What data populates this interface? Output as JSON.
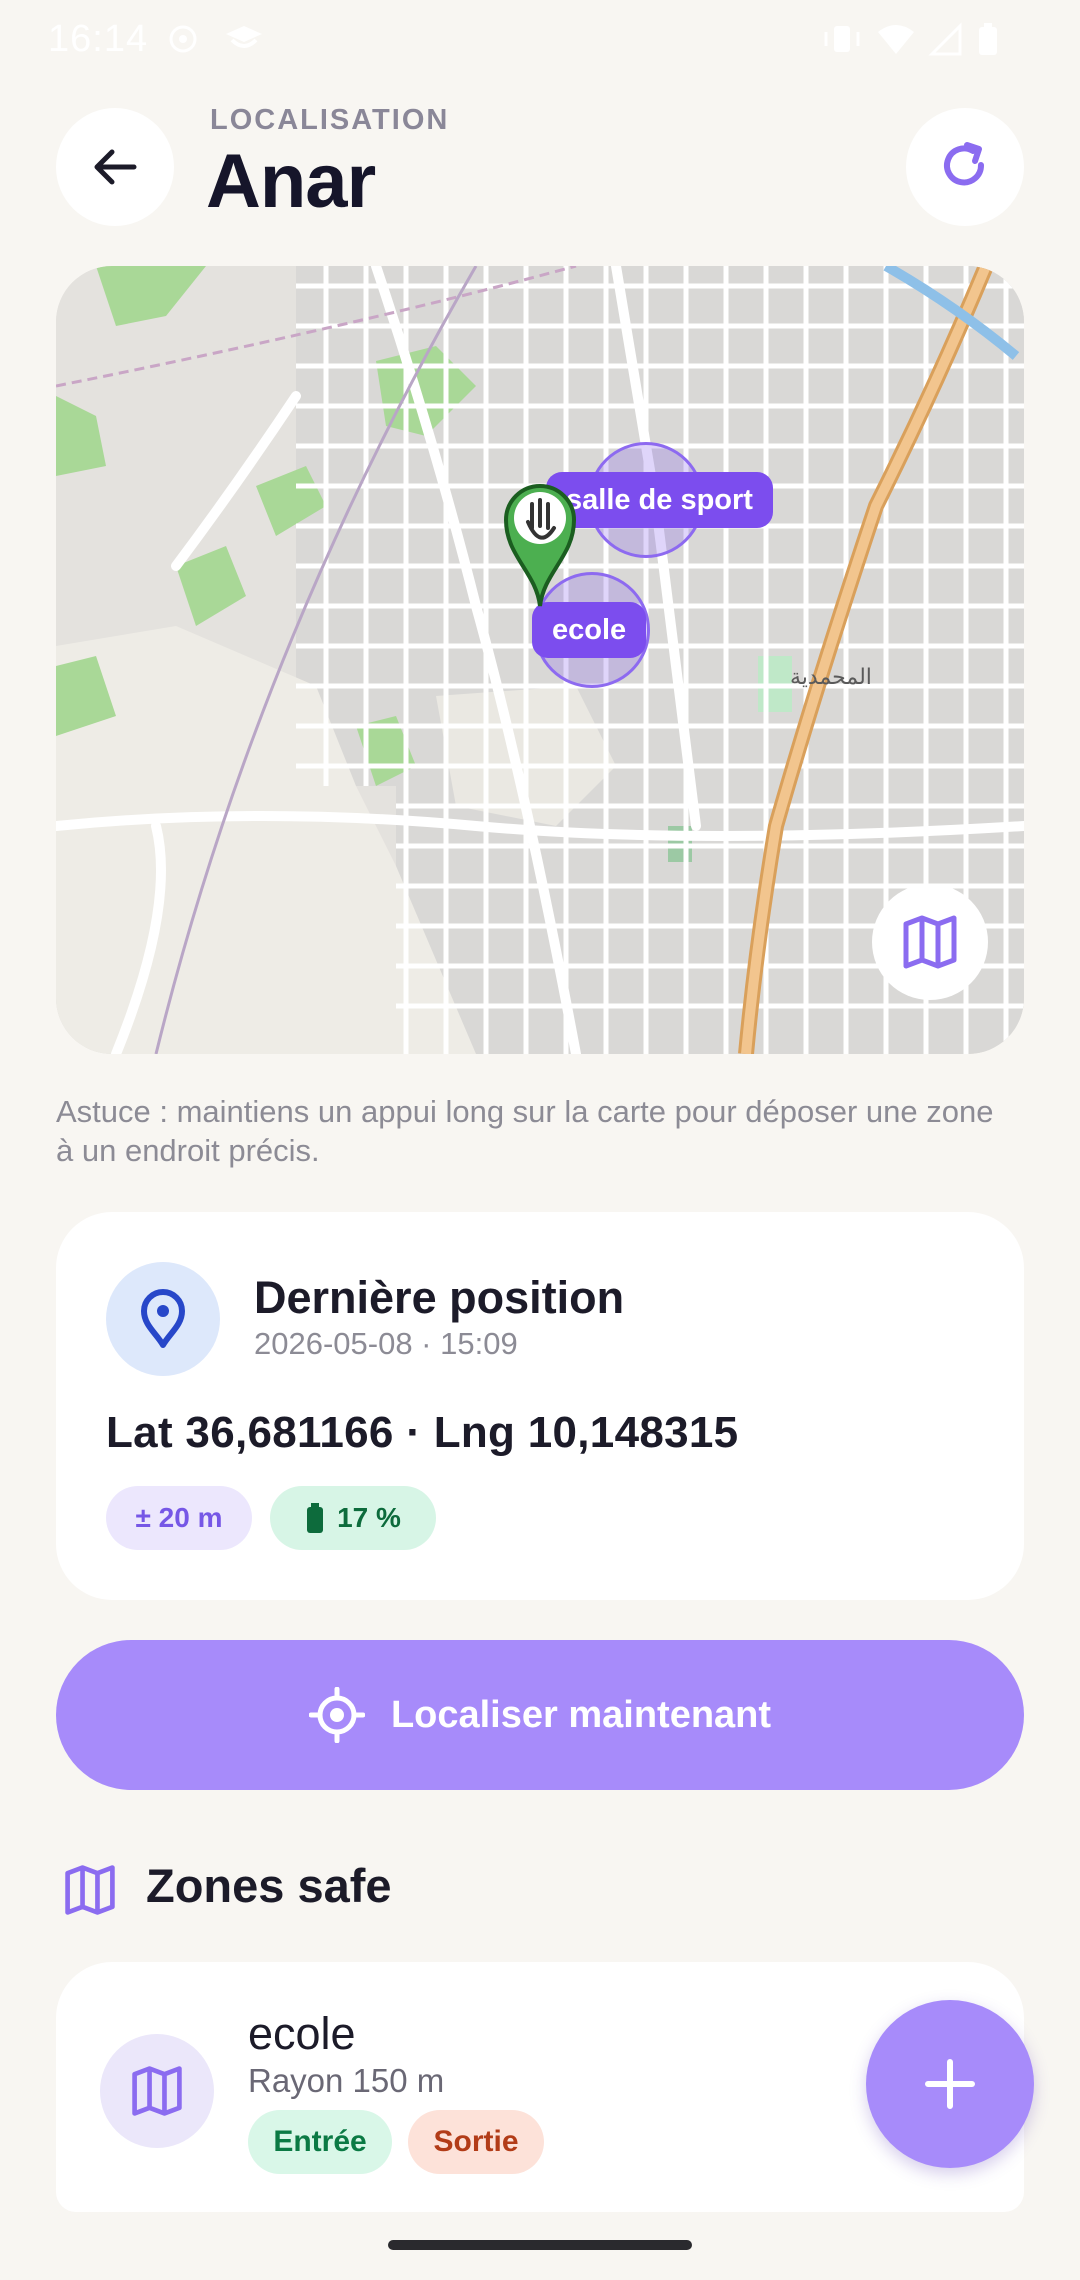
{
  "status_bar": {
    "time": "16:14"
  },
  "header": {
    "eyebrow": "LOCALISATION",
    "title": "Anar"
  },
  "map": {
    "zones": [
      {
        "name": "salle de sport"
      },
      {
        "name": "ecole"
      }
    ],
    "place_label": "المحمدية"
  },
  "hint": "Astuce : maintiens un appui long sur la carte pour déposer une zone à un endroit précis.",
  "position_card": {
    "title": "Dernière position",
    "timestamp": "2026-05-08 · 15:09",
    "coords": "Lat 36,681166 · Lng 10,148315",
    "accuracy": "± 20 m",
    "battery": "17 %"
  },
  "locate_button": {
    "label": "Localiser maintenant"
  },
  "zones_section": {
    "title": "Zones safe",
    "items": [
      {
        "name": "ecole",
        "radius": "Rayon 150 m",
        "tag_in": "Entrée",
        "tag_out": "Sortie"
      }
    ]
  },
  "colors": {
    "accent": "#a78bfa",
    "accent_dark": "#7c4dee",
    "background": "#f8f6f2",
    "marker": "#4caf50"
  },
  "icons": [
    "back-arrow-icon",
    "refresh-icon",
    "map-icon",
    "location-pin-icon",
    "battery-icon",
    "crosshair-icon",
    "plus-icon"
  ]
}
